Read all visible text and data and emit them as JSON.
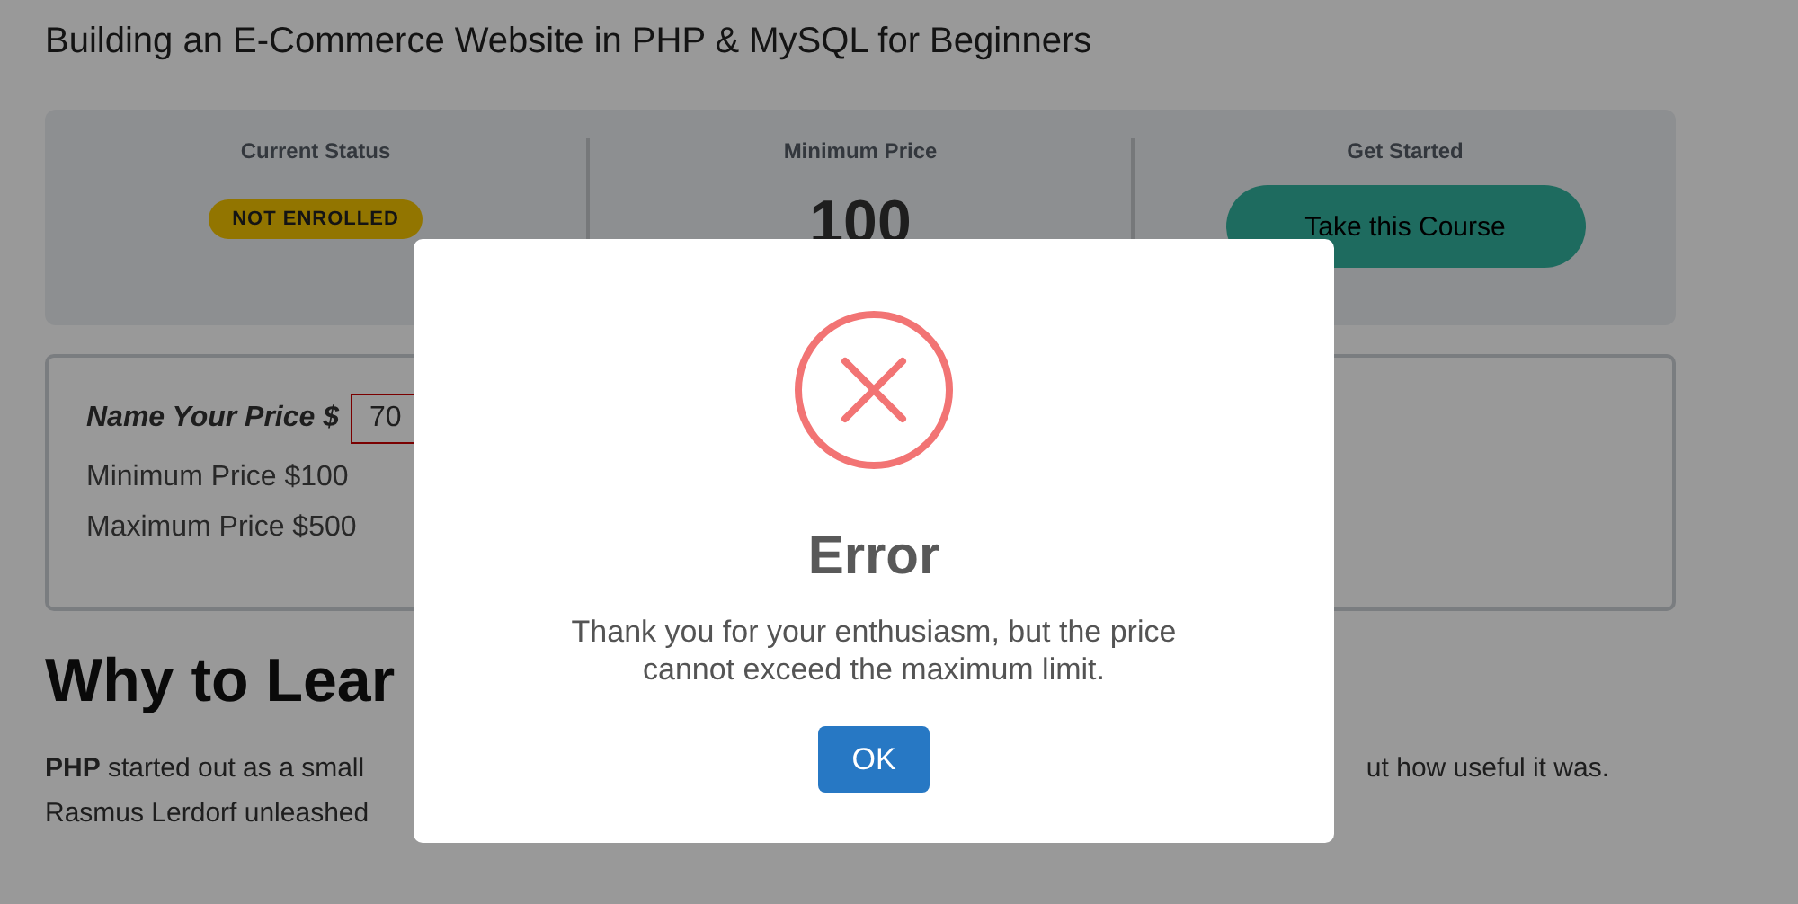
{
  "page_title": "Building an E-Commerce Website in PHP & MySQL for Beginners",
  "summary": [
    {
      "kind": "badge",
      "label": "Current Status",
      "value": "NOT ENROLLED"
    },
    {
      "kind": "price",
      "label": "Minimum Price",
      "value": "100"
    },
    {
      "kind": "button",
      "label": "Get Started",
      "value": "Take this Course"
    }
  ],
  "price_box": {
    "label": "Name Your Price $",
    "value": "70",
    "min_text": "Minimum Price $100",
    "max_text": "Maximum Price $500"
  },
  "section_heading": "Why to Lear",
  "paragraph_lines": [
    {
      "left": "**PHP** started out as a small",
      "right": "ut how useful it was."
    },
    {
      "left": "Rasmus Lerdorf unleashed"
    }
  ],
  "dialog": {
    "title": "Error",
    "message": "Thank you for your enthusiasm, but the price cannot exceed the maximum limit.",
    "button": "OK"
  }
}
